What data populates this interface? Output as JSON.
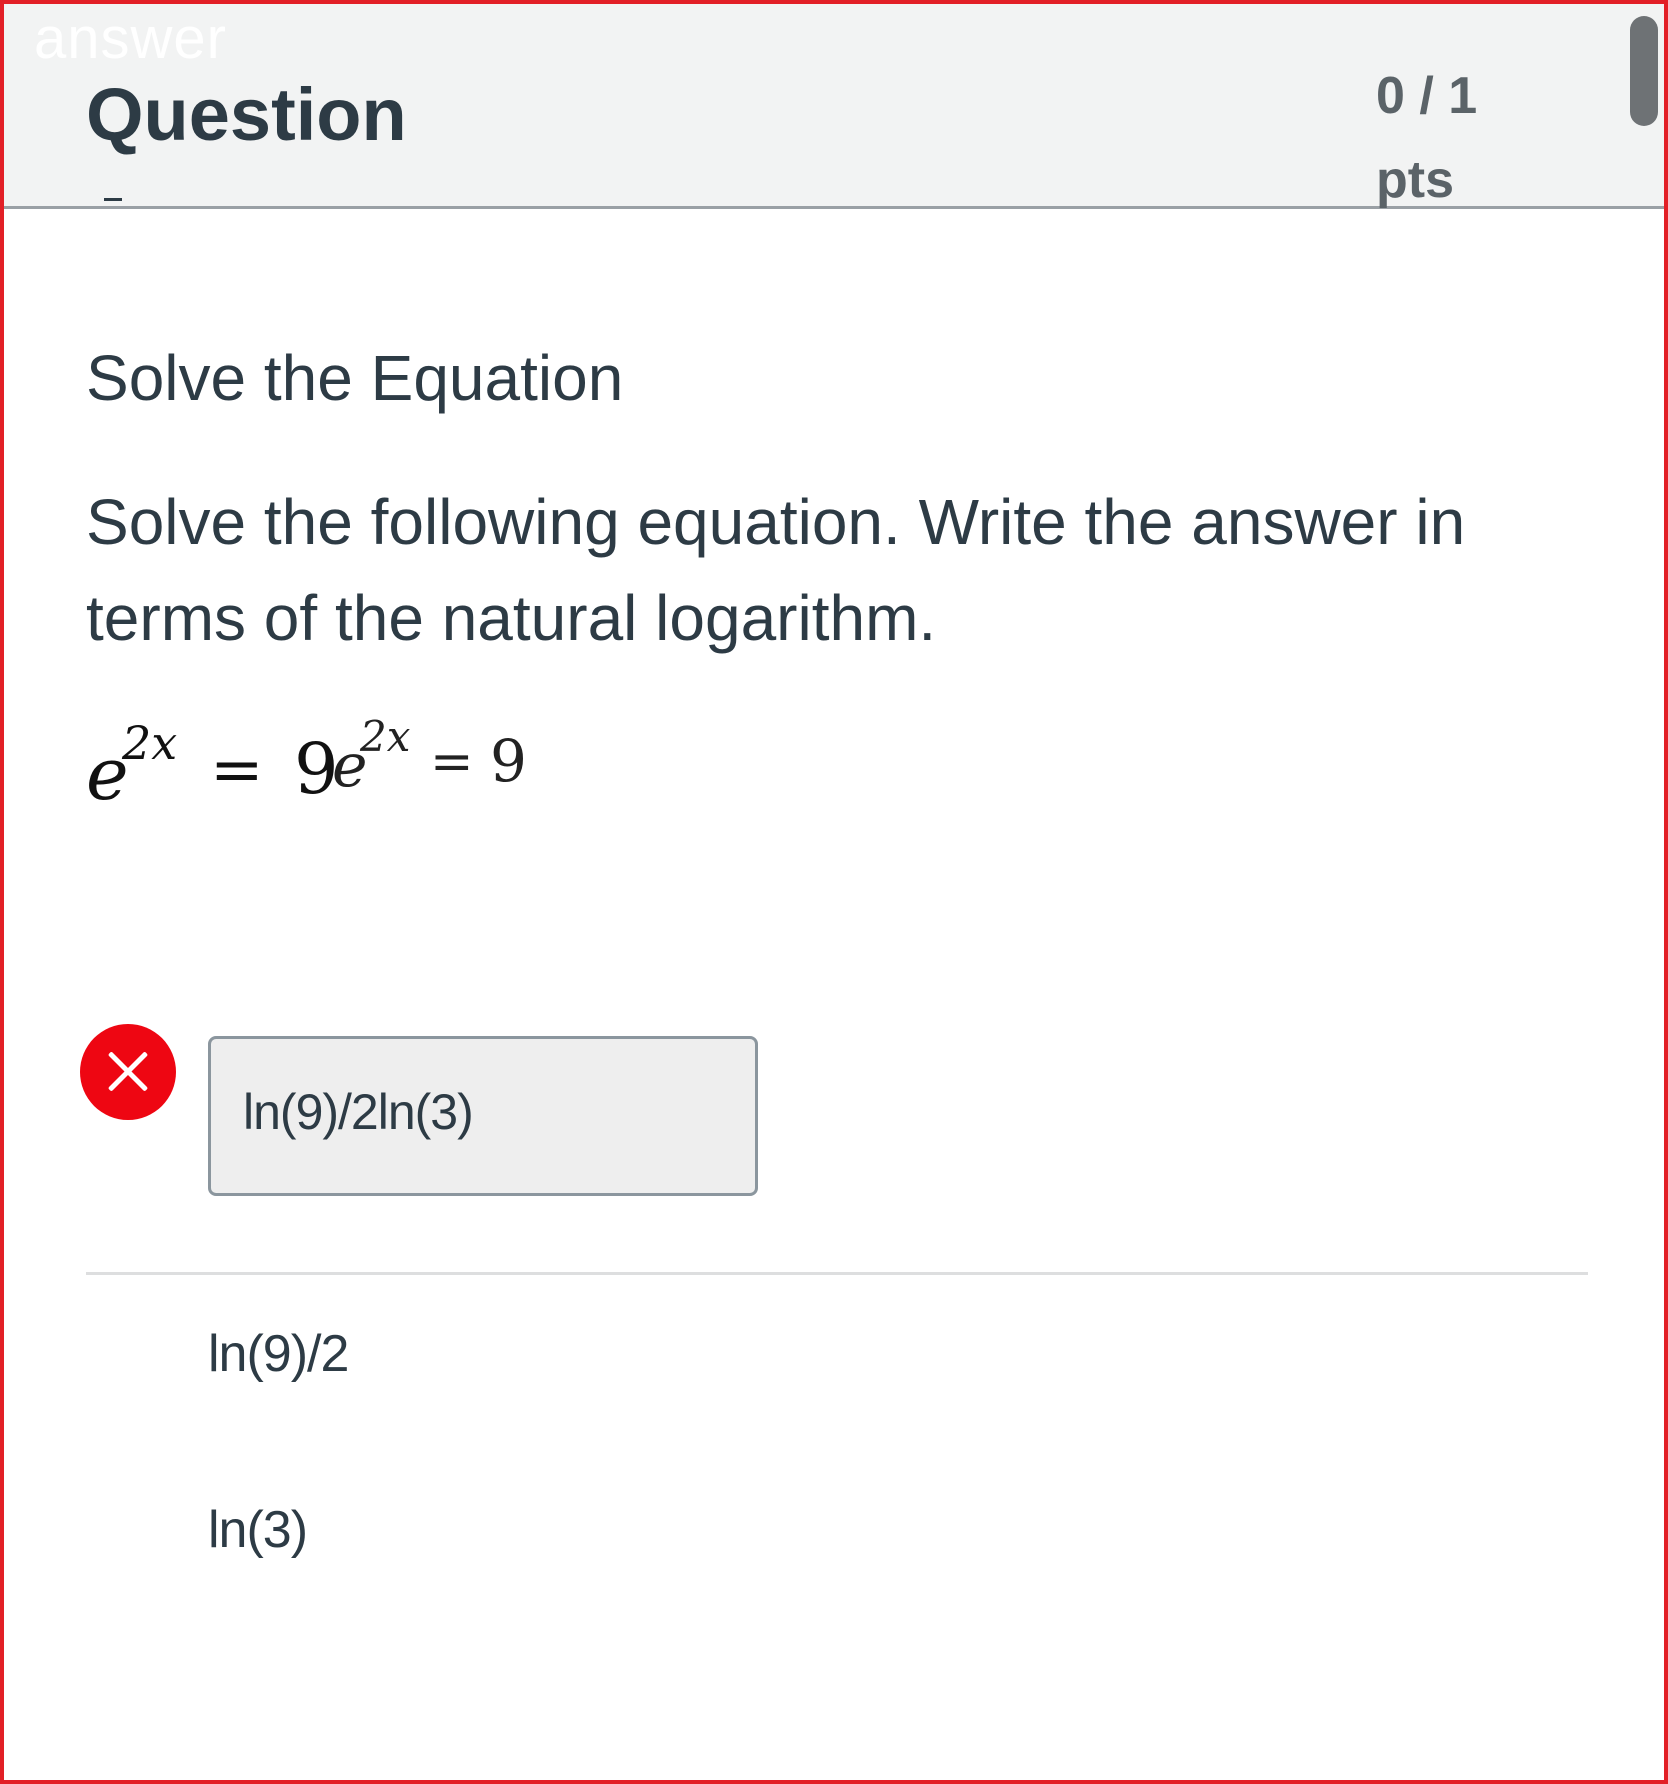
{
  "overlay_label": "answer",
  "header": {
    "title": "Question",
    "points_score": "0 / 1",
    "points_unit": "pts"
  },
  "question": {
    "title": "Solve the Equation",
    "instructions": "Solve the following equation. Write the answer in terms of the natural logarithm.",
    "equation": {
      "base_left": "e",
      "exp_left": "2x",
      "equals_1": "=",
      "coef": "9",
      "base_mid": "e",
      "exp_mid": "2x",
      "equals_2": "=",
      "rhs": "9"
    }
  },
  "student_answer": {
    "value": "ln(9)/2ln(3)",
    "status": "incorrect",
    "status_icon": "close-icon",
    "status_color": "#ee0612"
  },
  "correct_answers": [
    {
      "value": "ln(9)/2"
    },
    {
      "value": "ln(3)"
    }
  ],
  "colors": {
    "frame_border": "#e21f26",
    "header_bg": "#f2f3f3",
    "text": "#2d3b45",
    "points_text": "#5b6368",
    "answer_box_bg": "#eeeeee"
  }
}
